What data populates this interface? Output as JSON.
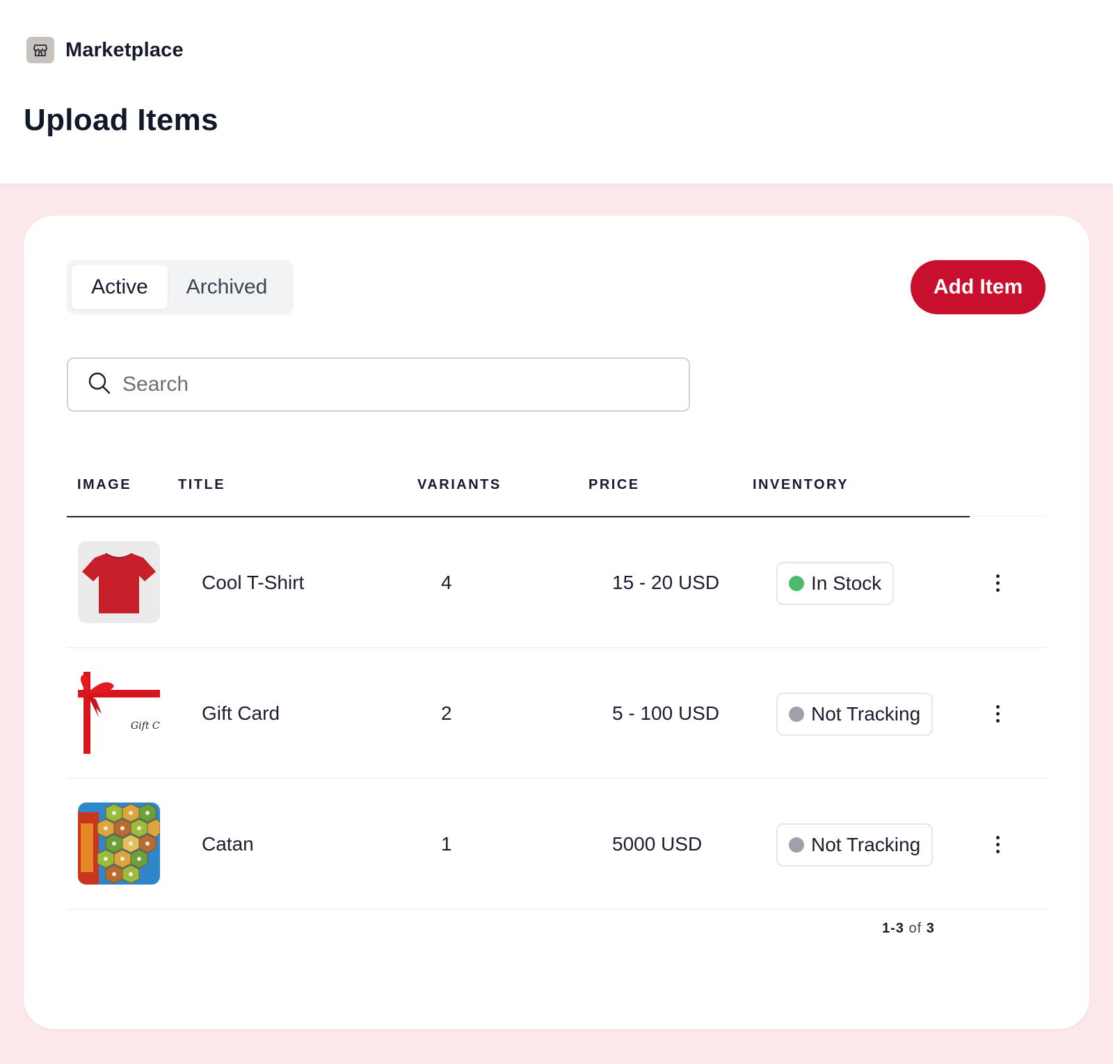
{
  "header": {
    "brand_name": "Marketplace",
    "brand_icon": "storefront-icon",
    "page_title": "Upload Items"
  },
  "tabs": [
    {
      "label": "Active",
      "selected": true
    },
    {
      "label": "Archived",
      "selected": false
    }
  ],
  "actions": {
    "add_item_label": "Add Item"
  },
  "search": {
    "placeholder": "Search",
    "value": ""
  },
  "table": {
    "columns": [
      "IMAGE",
      "TITLE",
      "VARIANTS",
      "PRICE",
      "INVENTORY"
    ],
    "rows": [
      {
        "image": "red-tshirt-thumbnail",
        "title": "Cool T-Shirt",
        "variants": "4",
        "price": "15 - 20 USD",
        "inventory": "In Stock",
        "inventory_color": "#4cbb6c"
      },
      {
        "image": "gift-card-thumbnail",
        "title": "Gift Card",
        "variants": "2",
        "price": "5 - 100 USD",
        "inventory": "Not Tracking",
        "inventory_color": "#9ea1aa"
      },
      {
        "image": "catan-board-thumbnail",
        "title": "Catan",
        "variants": "1",
        "price": "5000 USD",
        "inventory": "Not Tracking",
        "inventory_color": "#9ea1aa"
      }
    ]
  },
  "pagination": {
    "range": "1-3",
    "of": "of",
    "total": "3"
  },
  "colors": {
    "accent": "#c8102e",
    "background": "#fce8ea"
  }
}
